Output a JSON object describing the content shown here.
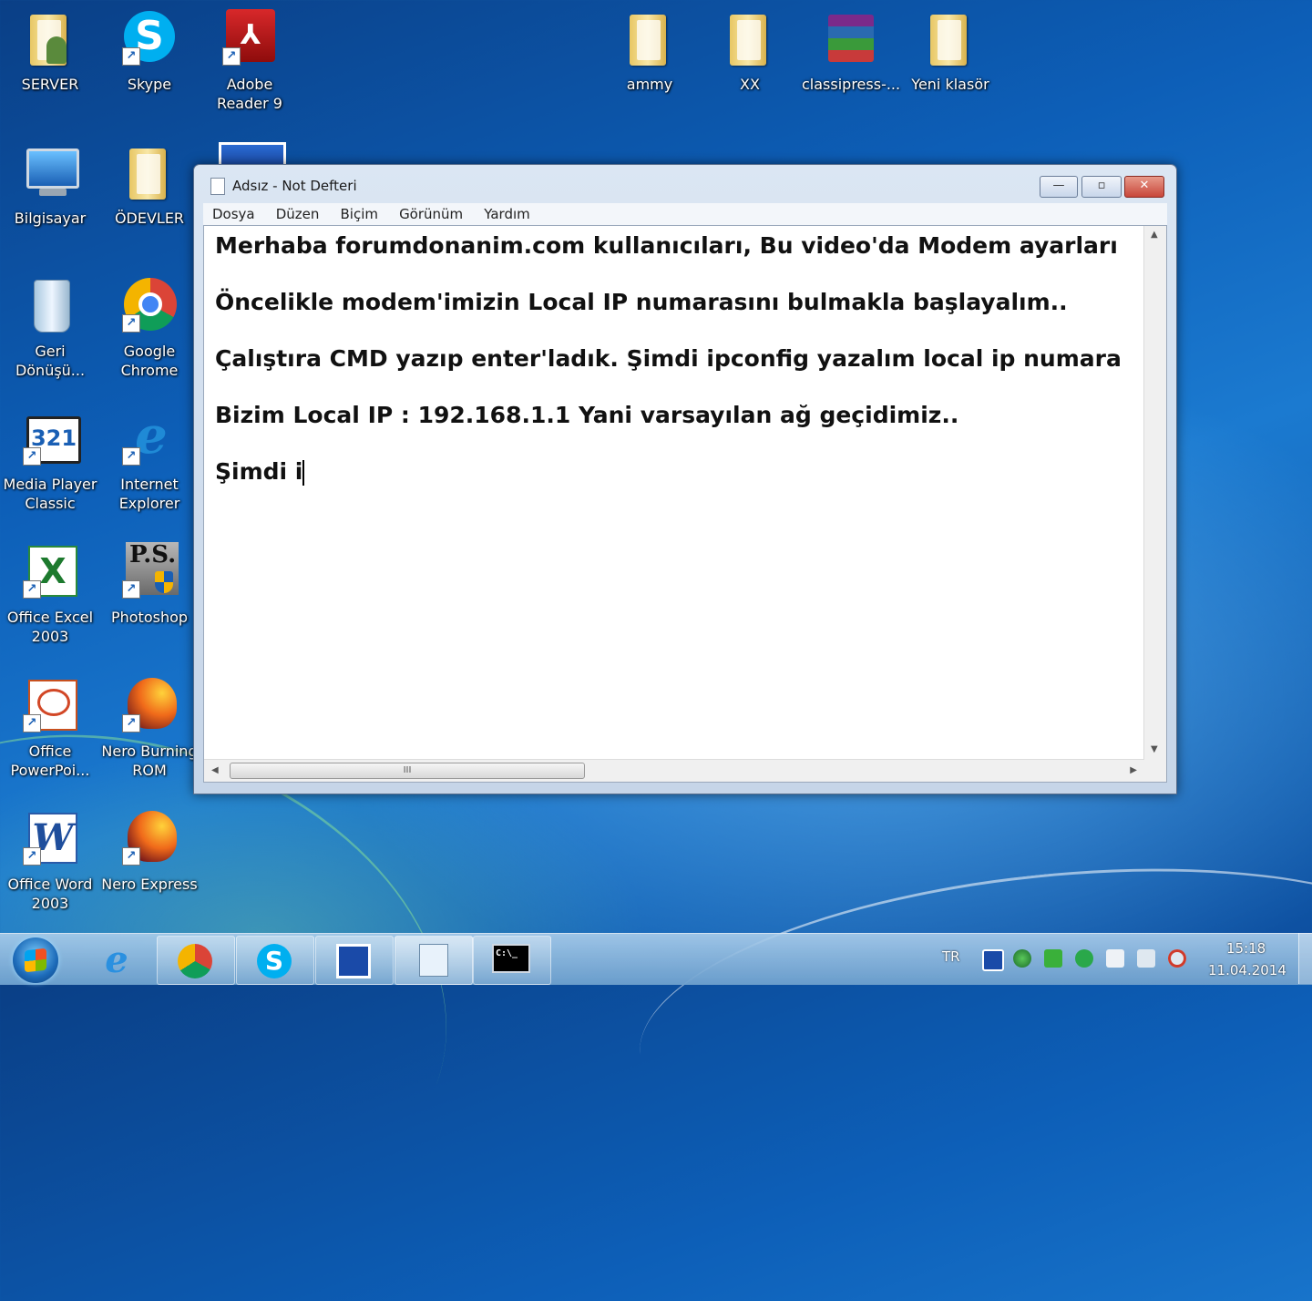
{
  "desktop": {
    "icons": [
      {
        "label": "SERVER"
      },
      {
        "label": "Skype"
      },
      {
        "label": "Adobe Reader 9"
      },
      {
        "label": "ammy"
      },
      {
        "label": "XX"
      },
      {
        "label": "classipress-..."
      },
      {
        "label": "Yeni klasör"
      },
      {
        "label": "Bilgisayar"
      },
      {
        "label": "ÖDEVLER"
      },
      {
        "label": "Geri Dönüşü..."
      },
      {
        "label": "Google Chrome"
      },
      {
        "label": "Media Player Classic"
      },
      {
        "label": "Internet Explorer"
      },
      {
        "label": "Office Excel 2003"
      },
      {
        "label": "Photoshop"
      },
      {
        "label": "Office PowerPoi..."
      },
      {
        "label": "Nero Burning ROM"
      },
      {
        "label": "Office Word 2003"
      },
      {
        "label": "Nero Express"
      }
    ]
  },
  "notepad": {
    "title": "Adsız - Not Defteri",
    "controls": {
      "minimize": "—",
      "maximize": "▫",
      "close": "✕"
    },
    "menu": [
      "Dosya",
      "Düzen",
      "Biçim",
      "Görünüm",
      "Yardım"
    ],
    "lines": [
      "Merhaba forumdonanim.com kullanıcıları, Bu video'da Modem ayarları",
      "Öncelikle modem'imizin Local IP numarasını bulmakla başlayalım..",
      "Çalıştıra CMD yazıp enter'ladık. Şimdi ipconfig yazalım local ip numara",
      "Bizim Local IP : 192.168.1.1 Yani varsayılan ağ geçidimiz..",
      "Şimdi i"
    ],
    "scroll_grip": "III"
  },
  "taskbar": {
    "items": [
      "start",
      "internet-explorer",
      "google-chrome",
      "skype",
      "remote-app",
      "notepad",
      "cmd"
    ],
    "tray": {
      "language": "TR",
      "time": "15:18",
      "date": "11.04.2014"
    }
  },
  "colors": {
    "accent": "#1b7ad0",
    "close_red": "#c8463a"
  }
}
